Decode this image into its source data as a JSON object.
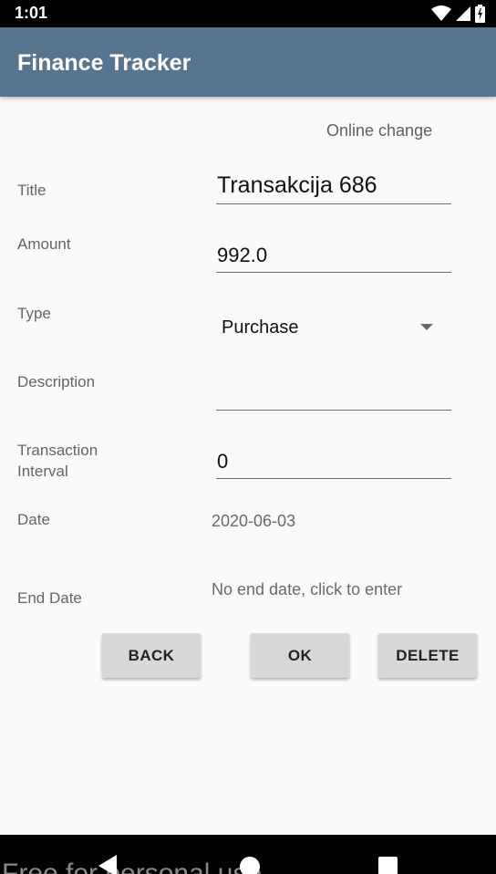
{
  "status_bar": {
    "time": "1:01",
    "icons": [
      "wifi-icon",
      "cell-signal-icon",
      "battery-icon"
    ]
  },
  "app_bar": {
    "title": "Finance Tracker",
    "color": "#58758f"
  },
  "form": {
    "online_change": "Online change",
    "title_label": "Title",
    "title_value": "Transakcija 686",
    "amount_label": "Amount",
    "amount_value": "992.0",
    "type_label": "Type",
    "type_value": "Purchase",
    "description_label": "Description",
    "description_value": "",
    "interval_label_line1": "Transaction",
    "interval_label_line2": "Interval",
    "interval_value": "0",
    "date_label": "Date",
    "date_value": "2020-06-03",
    "end_date_label": "End Date",
    "end_date_value": "No end date, click to enter"
  },
  "buttons": {
    "back": "BACK",
    "ok": "OK",
    "delete": "DELETE"
  },
  "nav_bar": {
    "watermark": "Free for personal use",
    "icons": [
      "back-icon",
      "home-icon",
      "recents-icon"
    ]
  }
}
